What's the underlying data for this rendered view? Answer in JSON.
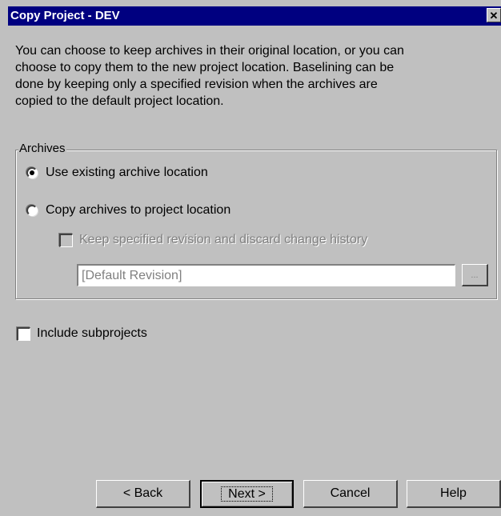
{
  "window": {
    "title": "Copy Project - DEV",
    "close_glyph": "✕"
  },
  "intro_text": "You can choose to keep archives in their original location, or you can\nchoose to copy them to the new project location.  Baselining can be\ndone by keeping only a specified revision when the archives are\ncopied to the default project location.",
  "archives_group": {
    "legend": "Archives",
    "options": [
      {
        "label": "Use existing archive location",
        "selected": true
      },
      {
        "label": "Copy archives to project location",
        "selected": false
      }
    ],
    "keep_revision": {
      "label": "Keep specified revision and discard change history",
      "checked": false,
      "enabled": false
    },
    "revision_field": {
      "value": "[Default Revision]",
      "enabled": false
    },
    "browse_label": "..."
  },
  "include_subprojects": {
    "label": "Include subprojects",
    "checked": false
  },
  "buttons": {
    "back": "< Back",
    "next": "Next >",
    "cancel": "Cancel",
    "help": "Help"
  }
}
